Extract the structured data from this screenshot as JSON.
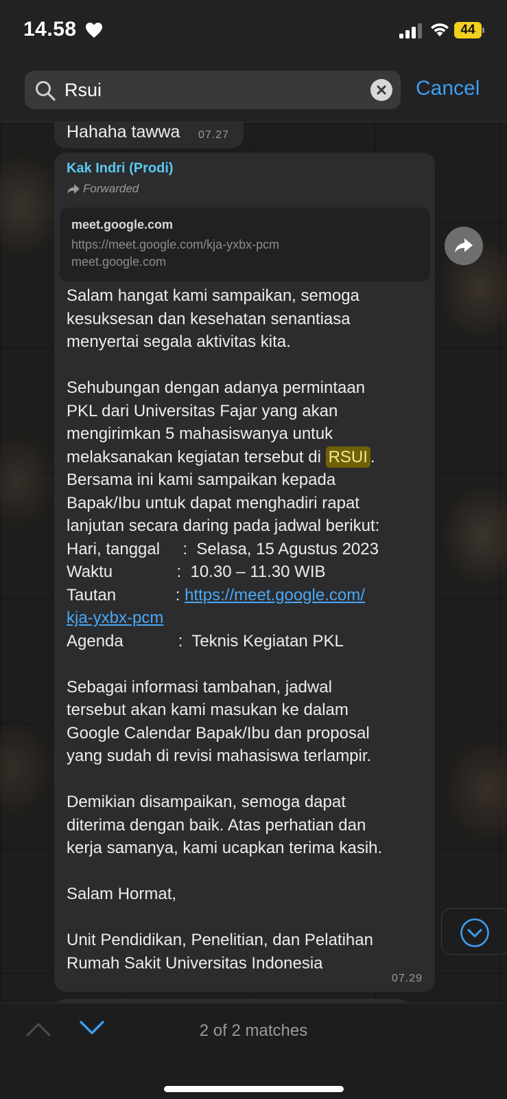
{
  "status_bar": {
    "time": "14.58",
    "battery": "44"
  },
  "search": {
    "query": "Rsui",
    "cancel_label": "Cancel"
  },
  "previous_message": {
    "text": "Hahaha tawwa",
    "time": "07.27"
  },
  "message": {
    "sender": "Kak Indri (Prodi)",
    "forwarded_label": "Forwarded",
    "link_preview": {
      "title": "meet.google.com",
      "url": "https://meet.google.com/kja-yxbx-pcm",
      "domain": "meet.google.com"
    },
    "lines": {
      "l1": "Salam hangat kami sampaikan, semoga",
      "l2": "kesuksesan dan kesehatan senantiasa",
      "l3": "menyertai segala aktivitas kita.",
      "l5": "Sehubungan dengan adanya permintaan",
      "l6": "PKL dari Universitas Fajar yang akan",
      "l7": "mengirimkan 5 mahasiswanya untuk",
      "l8_before": "melaksanakan kegiatan tersebut di ",
      "l8_highlight": "RSUI",
      "l8_after": ".",
      "l9": "Bersama ini kami sampaikan kepada",
      "l10": "Bapak/Ibu untuk dapat menghadiri rapat",
      "l11": "lanjutan secara daring pada jadwal berikut:",
      "l12": "Hari, tanggal     :  Selasa, 15 Agustus 2023",
      "l13": "Waktu              :  10.30 – 11.30 WIB",
      "l14_label": "Tautan             : ",
      "l14_link": "https://meet.google.com/",
      "l15_link": "kja-yxbx-pcm",
      "l16": "Agenda            :  Teknis Kegiatan PKL",
      "l18": "Sebagai informasi tambahan, jadwal",
      "l19": "tersebut akan kami masukan ke dalam",
      "l20": "Google Calendar Bapak/Ibu dan proposal",
      "l21": "yang sudah di revisi mahasiswa terlampir.",
      "l23": "Demikian disampaikan, semoga dapat",
      "l24": "diterima dengan baik. Atas perhatian dan",
      "l25": "kerja samanya, kami ucapkan terima kasih.",
      "l27": "Salam Hormat,",
      "l29": "Unit Pendidikan, Penelitian, dan Pelatihan",
      "l30": "Rumah Sakit Universitas Indonesia"
    },
    "time": "07.29"
  },
  "navigation": {
    "match_count": "2 of 2 matches"
  },
  "colors": {
    "accent": "#3d9ff0",
    "sender": "#5ac8f0",
    "highlight": "#6e6108",
    "bubble": "#2c2c2e"
  },
  "icons": [
    "heart-icon",
    "signal-icon",
    "wifi-icon",
    "search-icon",
    "clear-icon",
    "forward-icon",
    "share-icon",
    "chevron-down-circle-icon",
    "chevron-up-icon",
    "chevron-down-icon"
  ]
}
